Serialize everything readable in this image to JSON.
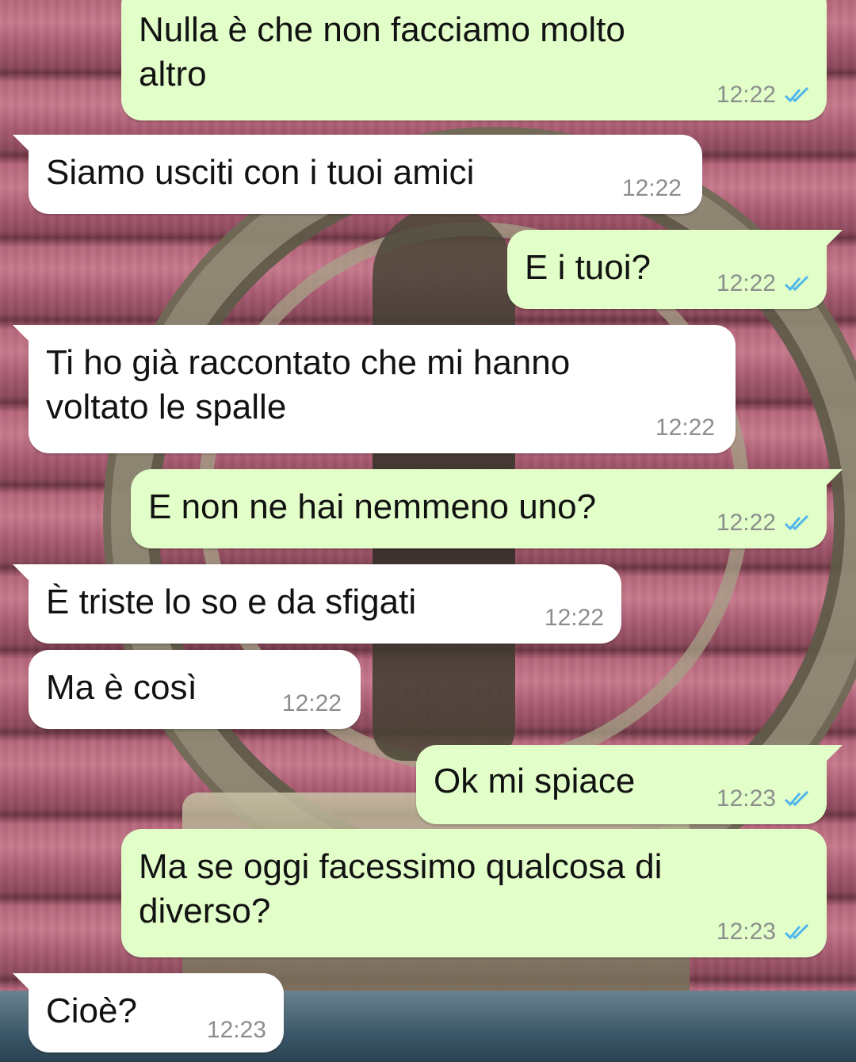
{
  "conversation": {
    "messages": [
      {
        "direction": "outgoing",
        "text": "Nulla è che non facciamo molto\naltro",
        "time": "12:22",
        "status_icon": "double-check-read-icon"
      },
      {
        "direction": "incoming",
        "text": "Siamo usciti con i tuoi amici",
        "time": "12:22"
      },
      {
        "direction": "outgoing",
        "text": "E i tuoi?",
        "time": "12:22",
        "status_icon": "double-check-read-icon"
      },
      {
        "direction": "incoming",
        "text": "Ti ho già raccontato che mi hanno\nvoltato le spalle",
        "time": "12:22"
      },
      {
        "direction": "outgoing",
        "text": "E non ne hai nemmeno uno?",
        "time": "12:22",
        "status_icon": "double-check-read-icon"
      },
      {
        "direction": "incoming",
        "text": "È triste lo so e da sfigati",
        "time": "12:22"
      },
      {
        "direction": "incoming",
        "text": "Ma è così",
        "time": "12:22"
      },
      {
        "direction": "outgoing",
        "text": "Ok mi spiace",
        "time": "12:23",
        "status_icon": "double-check-read-icon"
      },
      {
        "direction": "outgoing",
        "text": "Ma se oggi facessimo qualcosa di\ndiverso?",
        "time": "12:23",
        "status_icon": "double-check-read-icon"
      },
      {
        "direction": "incoming",
        "text": "Cioè?",
        "time": "12:23"
      }
    ]
  },
  "colors": {
    "outgoing_bubble": "#e2fec9",
    "incoming_bubble": "#ffffff",
    "read_ticks": "#4fb6ec",
    "timestamp": "#8b8f8c"
  }
}
